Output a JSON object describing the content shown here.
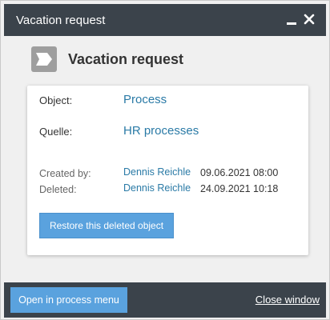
{
  "window": {
    "title": "Vacation request",
    "minimize_icon": "minimize-icon",
    "close_icon": "close-icon"
  },
  "header": {
    "icon": "process-chevron-icon",
    "title": "Vacation request"
  },
  "details": {
    "object_label": "Object:",
    "object_value": "Process",
    "source_label": "Quelle:",
    "source_value": "HR processes",
    "created_label": "Created by:",
    "created_user": "Dennis Reichle",
    "created_date": "09.06.2021 08:00",
    "deleted_label": "Deleted:",
    "deleted_user": "Dennis Reichle",
    "deleted_date": "24.09.2021 10:18"
  },
  "actions": {
    "restore_label": "Restore this deleted object"
  },
  "footer": {
    "open_label": "Open in process menu",
    "close_label": "Close window"
  },
  "colors": {
    "titlebar": "#3b434b",
    "accent_button": "#5aa2de",
    "link": "#2a7aa6"
  }
}
